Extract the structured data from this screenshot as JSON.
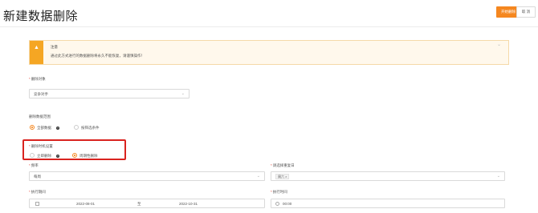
{
  "header": {
    "title": "新建数据删除",
    "start_button": "开始删除",
    "cancel_button": "取 消"
  },
  "notice": {
    "title": "注意",
    "text": "通过此方式进行的数据删除将永久不能恢复，请谨慎操作！"
  },
  "form": {
    "target_label": "删除对象",
    "target_value": "竞争对手",
    "scope_label": "删除数据范围",
    "scope_options": [
      "全部数据",
      "按筛选条件"
    ],
    "time_label": "删除时机设置",
    "time_options": [
      "立即删除",
      "周期性删除"
    ],
    "frequency_label": "频率",
    "frequency_value": "每周",
    "repeat_label": "请选择重复日",
    "repeat_tag": "周六",
    "period_label": "执行期间",
    "date_start": "2022-08-01",
    "date_sep": "至",
    "date_end": "2022-10-31",
    "exec_time_label": "执行时间",
    "exec_time_value": "00:00"
  },
  "colors": {
    "accent": "#f5871f",
    "highlight": "#d9231f",
    "notice_bg": "#fff8ec"
  }
}
